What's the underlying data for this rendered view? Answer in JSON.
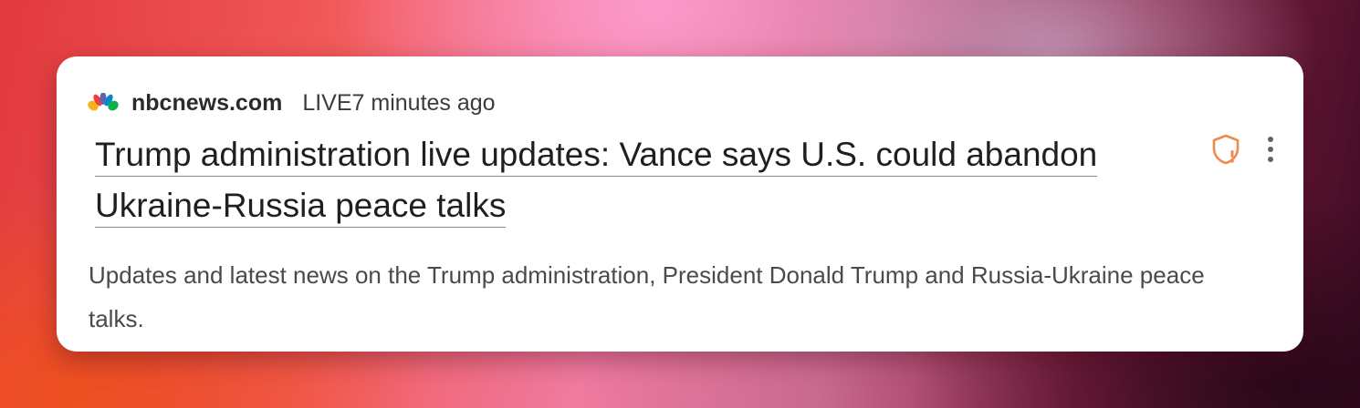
{
  "result": {
    "source": {
      "logo_icon": "nbc-peacock-logo",
      "domain": "nbcnews.com",
      "live_label": "LIVE",
      "timestamp": "7 minutes ago"
    },
    "headline_line1": "Trump administration live updates: Vance says U.S. could abandon",
    "headline_line2": "Ukraine-Russia peace talks",
    "snippet": "Updates and latest news on the Trump administration, President Donald Trump and Russia-Ukraine peace talks.",
    "actions": {
      "privacy_icon": "shield-alert-icon",
      "menu_icon": "more-vertical-icon"
    }
  },
  "colors": {
    "card_background": "#ffffff",
    "headline_text": "#1f1f1f",
    "snippet_text": "#4a4a4a",
    "shield_accent": "#ef8a4f"
  }
}
